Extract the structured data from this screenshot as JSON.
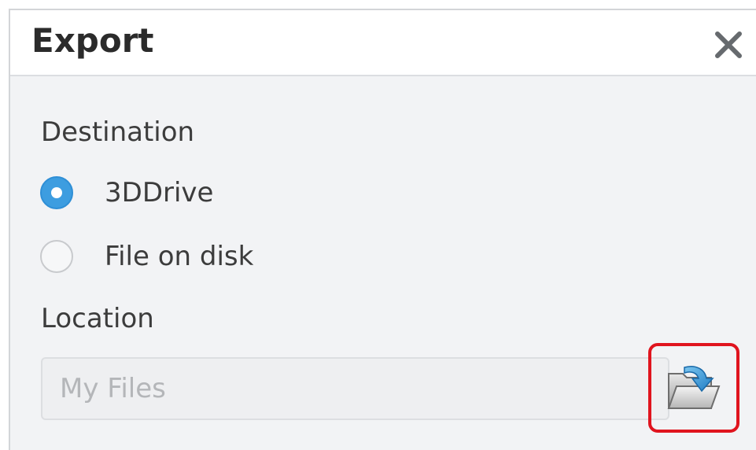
{
  "dialog": {
    "title": "Export",
    "close_icon": "close-icon"
  },
  "destination": {
    "label": "Destination",
    "options": [
      {
        "label": "3DDrive",
        "selected": true
      },
      {
        "label": "File on disk",
        "selected": false
      }
    ]
  },
  "location": {
    "label": "Location",
    "value": "My Files",
    "browse_icon": "folder-open-icon"
  },
  "colors": {
    "accent": "#3d9de0",
    "highlight": "#e0141e"
  }
}
